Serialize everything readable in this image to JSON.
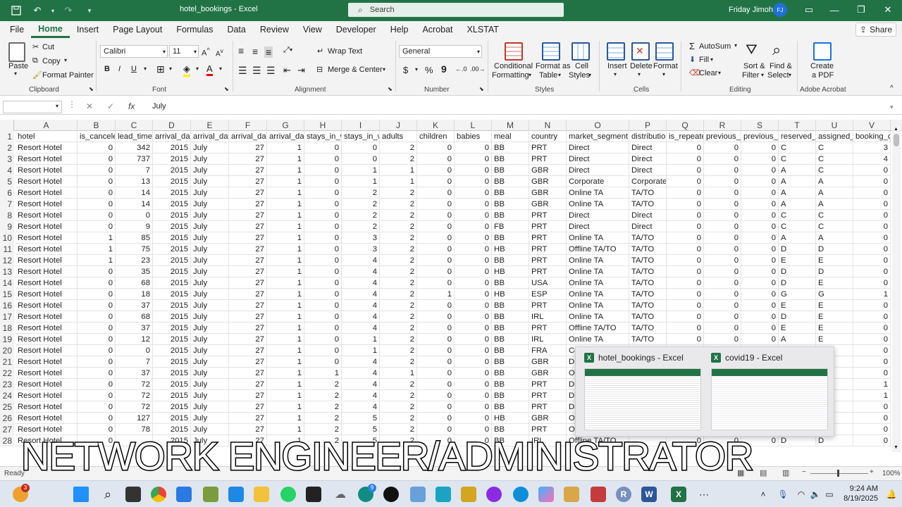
{
  "window": {
    "title": "hotel_bookings - Excel",
    "search_placeholder": "Search",
    "user_name": "Friday Jimoh",
    "user_initials": "FJ"
  },
  "menu_tabs": [
    "File",
    "Home",
    "Insert",
    "Page Layout",
    "Formulas",
    "Data",
    "Review",
    "View",
    "Developer",
    "Help",
    "Acrobat",
    "XLSTAT"
  ],
  "share_label": "Share",
  "ribbon": {
    "clipboard": {
      "paste": "Paste",
      "cut": "Cut",
      "copy": "Copy",
      "format_painter": "Format Painter",
      "label": "Clipboard"
    },
    "font": {
      "name": "Calibri",
      "size": "11",
      "label": "Font"
    },
    "alignment": {
      "wrap": "Wrap Text",
      "merge": "Merge & Center",
      "label": "Alignment"
    },
    "number": {
      "format": "General",
      "label": "Number"
    },
    "styles": {
      "conditional": "Conditional",
      "formatting": "Formatting",
      "format_as": "Format as",
      "table": "Table",
      "cell": "Cell",
      "cell_styles": "Styles",
      "label": "Styles"
    },
    "cells": {
      "insert": "Insert",
      "delete": "Delete",
      "format": "Format",
      "label": "Cells"
    },
    "editing": {
      "autosum": "AutoSum",
      "fill": "Fill",
      "clear": "Clear",
      "sort": "Sort &",
      "filter": "Filter",
      "find": "Find &",
      "select": "Select",
      "label": "Editing"
    },
    "acrobat": {
      "create": "Create",
      "pdf": "a PDF",
      "label": "Adobe Acrobat"
    }
  },
  "formula_bar": {
    "content": "July"
  },
  "columns": [
    "A",
    "B",
    "C",
    "D",
    "E",
    "F",
    "G",
    "H",
    "I",
    "J",
    "K",
    "L",
    "M",
    "N",
    "O",
    "P",
    "Q",
    "R",
    "S",
    "T",
    "U",
    "V"
  ],
  "header_row": [
    "hotel",
    "is_cancele",
    "lead_time",
    "arrival_dat",
    "arrival_dat",
    "arrival_dat",
    "arrival_dat",
    "stays_in_w",
    "stays_in_w",
    "adults",
    "children",
    "babies",
    "meal",
    "country",
    "market_segment",
    "distributio",
    "is_repeate",
    "previous_c",
    "previous_b",
    "reserved_r",
    "assigned_r",
    "booking_c"
  ],
  "rows": [
    [
      "Resort Hotel",
      "0",
      "342",
      "2015",
      "July",
      "27",
      "1",
      "0",
      "0",
      "2",
      "0",
      "0",
      "BB",
      "PRT",
      "Direct",
      "Direct",
      "0",
      "0",
      "0",
      "C",
      "C",
      "3"
    ],
    [
      "Resort Hotel",
      "0",
      "737",
      "2015",
      "July",
      "27",
      "1",
      "0",
      "0",
      "2",
      "0",
      "0",
      "BB",
      "PRT",
      "Direct",
      "Direct",
      "0",
      "0",
      "0",
      "C",
      "C",
      "4"
    ],
    [
      "Resort Hotel",
      "0",
      "7",
      "2015",
      "July",
      "27",
      "1",
      "0",
      "1",
      "1",
      "0",
      "0",
      "BB",
      "GBR",
      "Direct",
      "Direct",
      "0",
      "0",
      "0",
      "A",
      "C",
      "0"
    ],
    [
      "Resort Hotel",
      "0",
      "13",
      "2015",
      "July",
      "27",
      "1",
      "0",
      "1",
      "1",
      "0",
      "0",
      "BB",
      "GBR",
      "Corporate",
      "Corporate",
      "0",
      "0",
      "0",
      "A",
      "A",
      "0"
    ],
    [
      "Resort Hotel",
      "0",
      "14",
      "2015",
      "July",
      "27",
      "1",
      "0",
      "2",
      "2",
      "0",
      "0",
      "BB",
      "GBR",
      "Online TA",
      "TA/TO",
      "0",
      "0",
      "0",
      "A",
      "A",
      "0"
    ],
    [
      "Resort Hotel",
      "0",
      "14",
      "2015",
      "July",
      "27",
      "1",
      "0",
      "2",
      "2",
      "0",
      "0",
      "BB",
      "GBR",
      "Online TA",
      "TA/TO",
      "0",
      "0",
      "0",
      "A",
      "A",
      "0"
    ],
    [
      "Resort Hotel",
      "0",
      "0",
      "2015",
      "July",
      "27",
      "1",
      "0",
      "2",
      "2",
      "0",
      "0",
      "BB",
      "PRT",
      "Direct",
      "Direct",
      "0",
      "0",
      "0",
      "C",
      "C",
      "0"
    ],
    [
      "Resort Hotel",
      "0",
      "9",
      "2015",
      "July",
      "27",
      "1",
      "0",
      "2",
      "2",
      "0",
      "0",
      "FB",
      "PRT",
      "Direct",
      "Direct",
      "0",
      "0",
      "0",
      "C",
      "C",
      "0"
    ],
    [
      "Resort Hotel",
      "1",
      "85",
      "2015",
      "July",
      "27",
      "1",
      "0",
      "3",
      "2",
      "0",
      "0",
      "BB",
      "PRT",
      "Online TA",
      "TA/TO",
      "0",
      "0",
      "0",
      "A",
      "A",
      "0"
    ],
    [
      "Resort Hotel",
      "1",
      "75",
      "2015",
      "July",
      "27",
      "1",
      "0",
      "3",
      "2",
      "0",
      "0",
      "HB",
      "PRT",
      "Offline TA/TO",
      "TA/TO",
      "0",
      "0",
      "0",
      "D",
      "D",
      "0"
    ],
    [
      "Resort Hotel",
      "1",
      "23",
      "2015",
      "July",
      "27",
      "1",
      "0",
      "4",
      "2",
      "0",
      "0",
      "BB",
      "PRT",
      "Online TA",
      "TA/TO",
      "0",
      "0",
      "0",
      "E",
      "E",
      "0"
    ],
    [
      "Resort Hotel",
      "0",
      "35",
      "2015",
      "July",
      "27",
      "1",
      "0",
      "4",
      "2",
      "0",
      "0",
      "HB",
      "PRT",
      "Online TA",
      "TA/TO",
      "0",
      "0",
      "0",
      "D",
      "D",
      "0"
    ],
    [
      "Resort Hotel",
      "0",
      "68",
      "2015",
      "July",
      "27",
      "1",
      "0",
      "4",
      "2",
      "0",
      "0",
      "BB",
      "USA",
      "Online TA",
      "TA/TO",
      "0",
      "0",
      "0",
      "D",
      "E",
      "0"
    ],
    [
      "Resort Hotel",
      "0",
      "18",
      "2015",
      "July",
      "27",
      "1",
      "0",
      "4",
      "2",
      "1",
      "0",
      "HB",
      "ESP",
      "Online TA",
      "TA/TO",
      "0",
      "0",
      "0",
      "G",
      "G",
      "1"
    ],
    [
      "Resort Hotel",
      "0",
      "37",
      "2015",
      "July",
      "27",
      "1",
      "0",
      "4",
      "2",
      "0",
      "0",
      "BB",
      "PRT",
      "Online TA",
      "TA/TO",
      "0",
      "0",
      "0",
      "E",
      "E",
      "0"
    ],
    [
      "Resort Hotel",
      "0",
      "68",
      "2015",
      "July",
      "27",
      "1",
      "0",
      "4",
      "2",
      "0",
      "0",
      "BB",
      "IRL",
      "Online TA",
      "TA/TO",
      "0",
      "0",
      "0",
      "D",
      "E",
      "0"
    ],
    [
      "Resort Hotel",
      "0",
      "37",
      "2015",
      "July",
      "27",
      "1",
      "0",
      "4",
      "2",
      "0",
      "0",
      "BB",
      "PRT",
      "Offline TA/TO",
      "TA/TO",
      "0",
      "0",
      "0",
      "E",
      "E",
      "0"
    ],
    [
      "Resort Hotel",
      "0",
      "12",
      "2015",
      "July",
      "27",
      "1",
      "0",
      "1",
      "2",
      "0",
      "0",
      "BB",
      "IRL",
      "Online TA",
      "TA/TO",
      "0",
      "0",
      "0",
      "A",
      "E",
      "0"
    ],
    [
      "Resort Hotel",
      "0",
      "0",
      "2015",
      "July",
      "27",
      "1",
      "0",
      "1",
      "2",
      "0",
      "0",
      "BB",
      "FRA",
      "Corp",
      "",
      "",
      "",
      "",
      "",
      "",
      "0"
    ],
    [
      "Resort Hotel",
      "0",
      "7",
      "2015",
      "July",
      "27",
      "1",
      "0",
      "4",
      "2",
      "0",
      "0",
      "BB",
      "GBR",
      "Dire",
      "",
      "",
      "",
      "",
      "",
      "",
      "0"
    ],
    [
      "Resort Hotel",
      "0",
      "37",
      "2015",
      "July",
      "27",
      "1",
      "1",
      "4",
      "1",
      "0",
      "0",
      "BB",
      "GBR",
      "Onli",
      "",
      "",
      "",
      "",
      "",
      "",
      "0"
    ],
    [
      "Resort Hotel",
      "0",
      "72",
      "2015",
      "July",
      "27",
      "1",
      "2",
      "4",
      "2",
      "0",
      "0",
      "BB",
      "PRT",
      "Dire",
      "",
      "",
      "",
      "",
      "",
      "",
      "1"
    ],
    [
      "Resort Hotel",
      "0",
      "72",
      "2015",
      "July",
      "27",
      "1",
      "2",
      "4",
      "2",
      "0",
      "0",
      "BB",
      "PRT",
      "Dire",
      "",
      "",
      "",
      "",
      "",
      "",
      "1"
    ],
    [
      "Resort Hotel",
      "0",
      "72",
      "2015",
      "July",
      "27",
      "1",
      "2",
      "4",
      "2",
      "0",
      "0",
      "BB",
      "PRT",
      "Dire",
      "",
      "",
      "",
      "",
      "",
      "",
      "0"
    ],
    [
      "Resort Hotel",
      "0",
      "127",
      "2015",
      "July",
      "27",
      "1",
      "2",
      "5",
      "2",
      "0",
      "0",
      "HB",
      "GBR",
      "Offl",
      "",
      "",
      "",
      "",
      "",
      "",
      "0"
    ],
    [
      "Resort Hotel",
      "0",
      "78",
      "2015",
      "July",
      "27",
      "1",
      "2",
      "5",
      "2",
      "0",
      "0",
      "BB",
      "PRT",
      "Offl",
      "",
      "",
      "",
      "",
      "",
      "",
      "0"
    ],
    [
      "Resort Hotel",
      "0",
      "",
      "2015",
      "July",
      "27",
      "1",
      "2",
      "5",
      "2",
      "0",
      "0",
      "BB",
      "IRL",
      "Offline TA/TO",
      "",
      "0",
      "0",
      "0",
      "D",
      "D",
      "0"
    ]
  ],
  "window_previews": [
    {
      "title": "hotel_bookings - Excel"
    },
    {
      "title": "covid19 - Excel"
    }
  ],
  "status": {
    "ready": "Ready",
    "zoom": "100%"
  },
  "overlay_text": "NETWORK ENGINEER/ADMINISTRATOR",
  "taskbar": {
    "time": "9:24 AM",
    "date": "8/19/2025",
    "badge_weather": "3",
    "badge_whatsapp": "9"
  }
}
